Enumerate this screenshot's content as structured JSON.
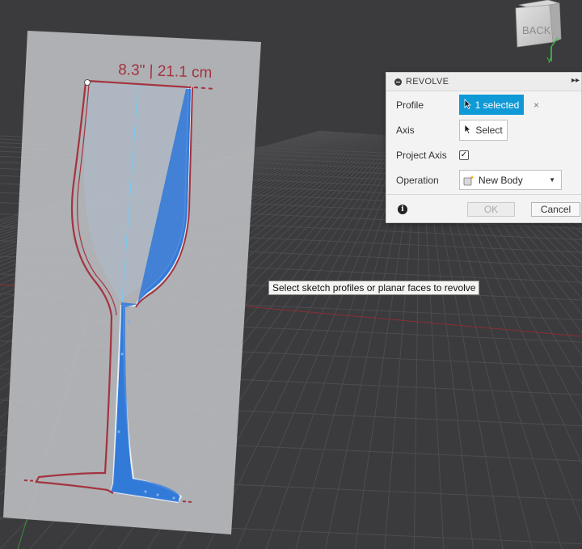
{
  "canvas": {
    "dimension_label": "8.3\" | 21.1 cm"
  },
  "view_cube": {
    "face_label": "BACK",
    "axis_y_color": "#3ccc3c"
  },
  "revolve_dialog": {
    "title": "REVOLVE",
    "profile": {
      "label": "Profile",
      "value": "1 selected",
      "clear_symbol": "×"
    },
    "axis": {
      "label": "Axis",
      "value": "Select"
    },
    "project_axis": {
      "label": "Project Axis",
      "checked": true,
      "check_symbol": "✓"
    },
    "operation": {
      "label": "Operation",
      "value": "New Body"
    },
    "ok_label": "OK",
    "cancel_label": "Cancel",
    "accent_color": "#0f99d6"
  },
  "tooltip": {
    "text": "Select sketch profiles or planar faces to revolve"
  },
  "colors": {
    "background": "#3b3b3d",
    "sketch_line": "#a3343f",
    "profile_fill": "#3a7fd6",
    "axis_line": "#7ec8f0"
  }
}
